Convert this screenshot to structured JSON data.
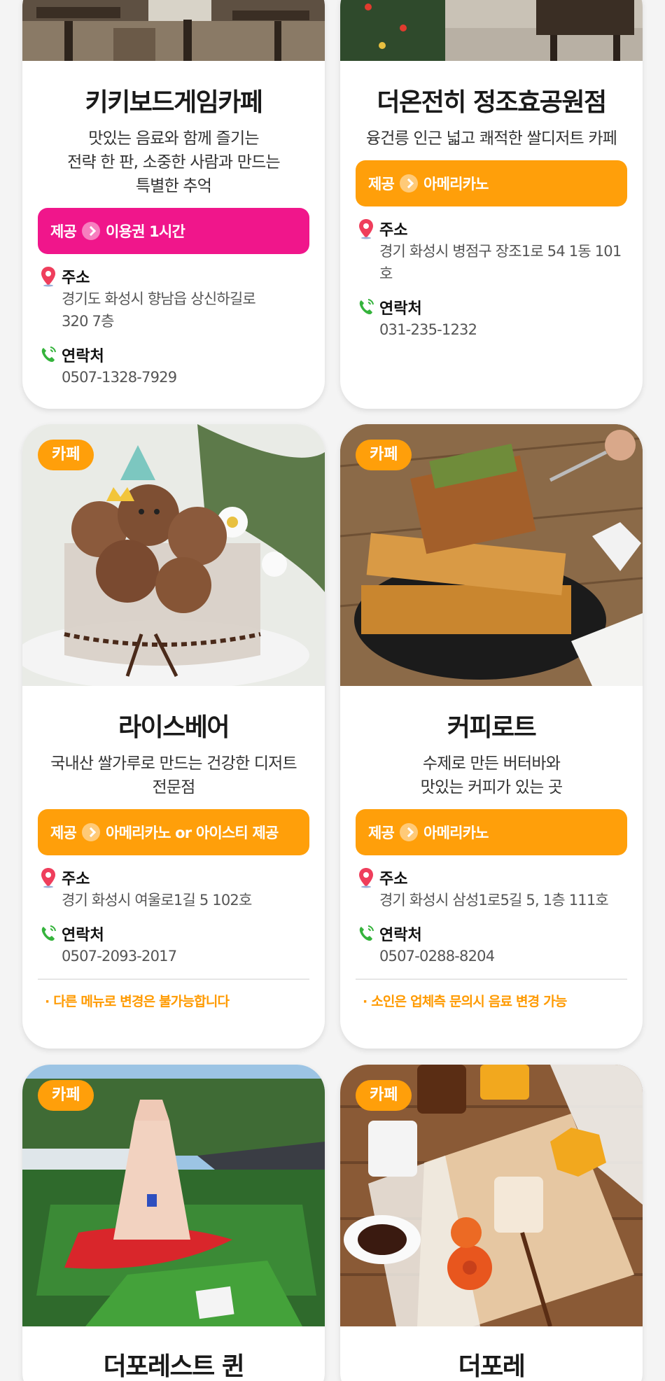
{
  "colors": {
    "pink": "#f0168b",
    "orange": "#ff9f0a",
    "pin": "#ef3e5c",
    "phone": "#35b33c"
  },
  "labels": {
    "offer_prefix": "제공",
    "address": "주소",
    "contact": "연락처"
  },
  "cards": [
    {
      "badge": "",
      "title": "키키보드게임카페",
      "desc": [
        "맛있는 음료와 함께 즐기는",
        "전략 한 판, 소중한 사람과 만드는",
        "특별한 추억"
      ],
      "offer": "이용권 1시간",
      "address": [
        "경기도 화성시 향남읍 상신하길로",
        "320 7층"
      ],
      "phone": "0507-1328-7929",
      "note": ""
    },
    {
      "badge": "",
      "title": "더온전히 정조효공원점",
      "desc": [
        "융건릉 인근 넓고 쾌적한 쌀디저트 카페"
      ],
      "offer": "아메리카노",
      "address": [
        "경기 화성시 병점구 장조1로 54 1동 101호"
      ],
      "phone": "031-235-1232",
      "note": ""
    },
    {
      "badge": "카페",
      "title": "라이스베어",
      "desc": [
        "국내산 쌀가루로 만드는 건강한 디저트",
        "전문점"
      ],
      "offer": "아메리카노 or 아이스티 제공",
      "address": [
        "경기 화성시 여울로1길 5 102호"
      ],
      "phone": "0507-2093-2017",
      "note": "· 다른 메뉴로 변경은 불가능합니다"
    },
    {
      "badge": "카페",
      "title": "커피로트",
      "desc": [
        "수제로 만든 버터바와",
        "맛있는 커피가 있는 곳"
      ],
      "offer": "아메리카노",
      "address": [
        "경기 화성시 삼성1로5길 5, 1층 111호"
      ],
      "phone": "0507-0288-8204",
      "note": "· 소인은 업체측 문의시 음료 변경 가능"
    },
    {
      "badge": "카페",
      "title": "더포레스트 퀸"
    },
    {
      "badge": "카페",
      "title": "더포레"
    }
  ]
}
